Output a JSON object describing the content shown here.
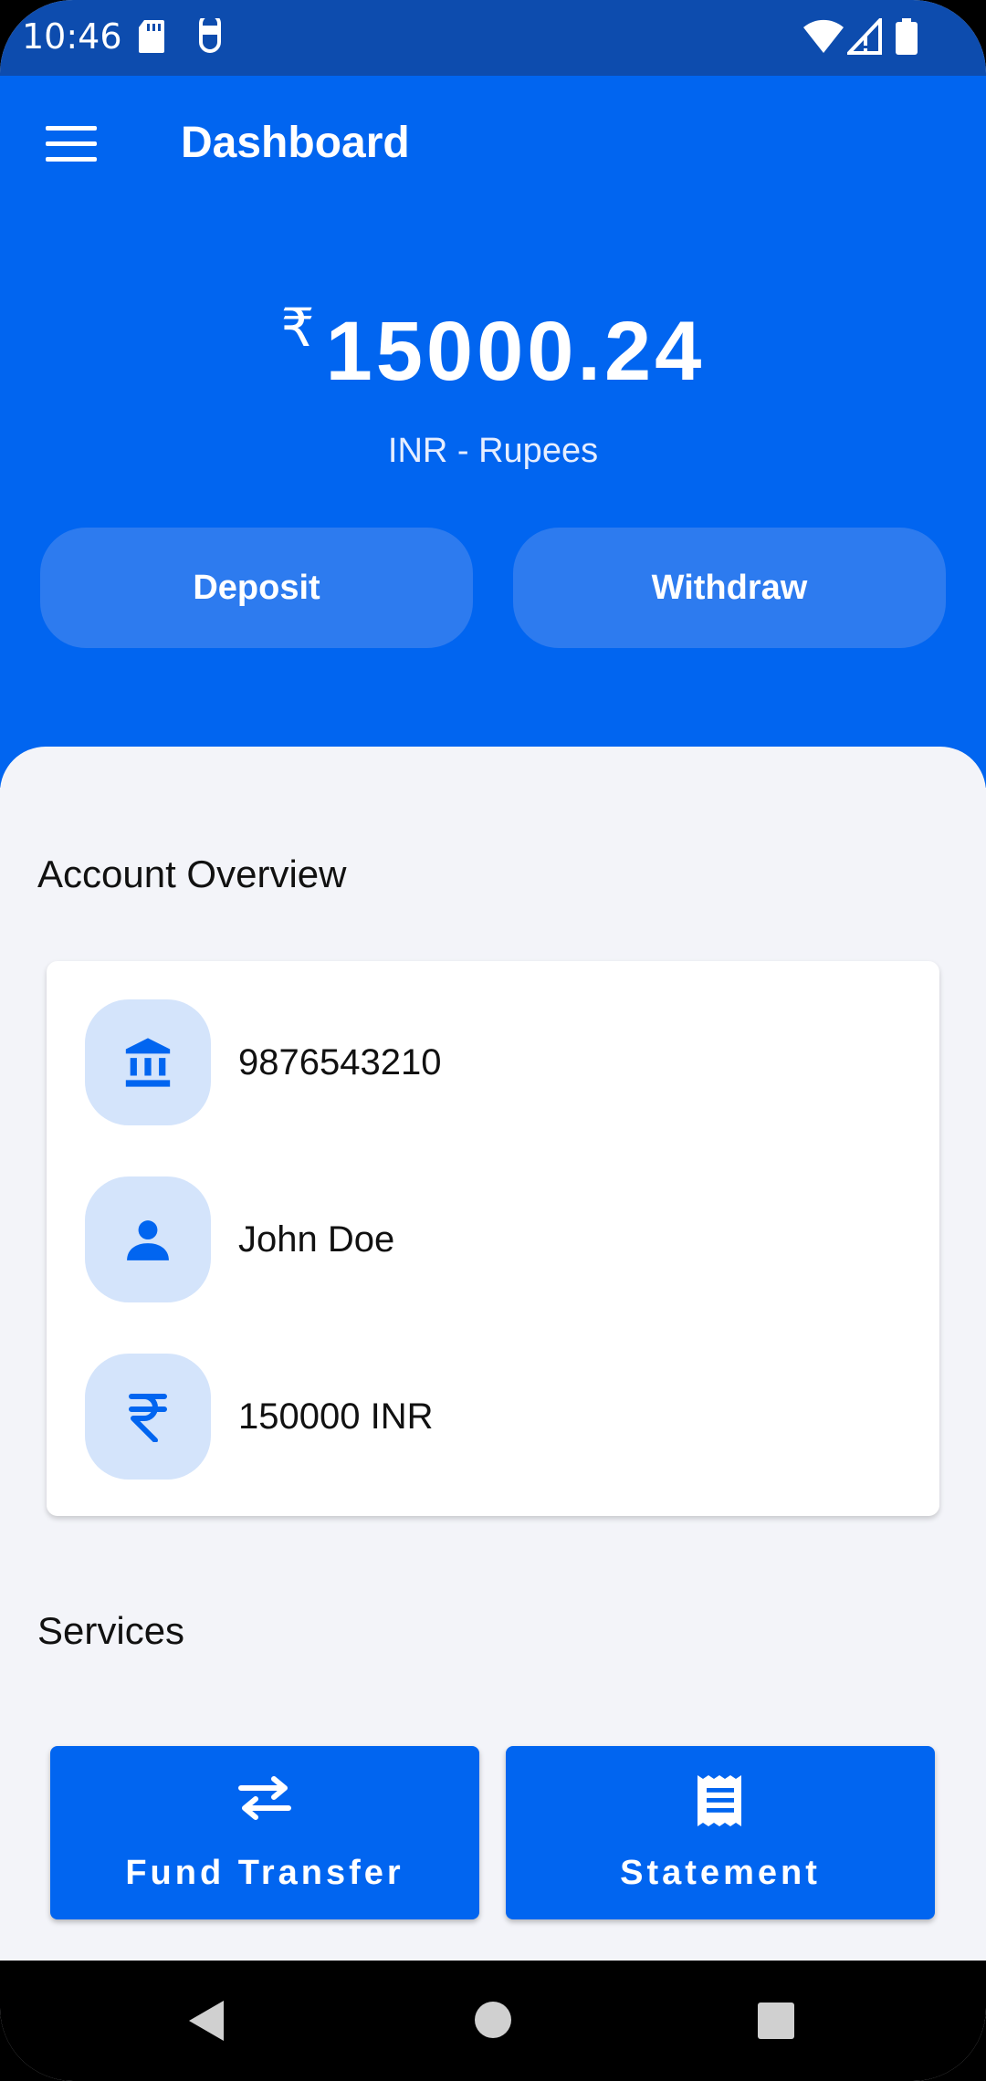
{
  "status_bar": {
    "time": "10:46"
  },
  "header": {
    "title": "Dashboard"
  },
  "balance": {
    "symbol": "₹",
    "amount": "15000.24",
    "currency_label": "INR - Rupees"
  },
  "actions": {
    "deposit_label": "Deposit",
    "withdraw_label": "Withdraw"
  },
  "overview": {
    "title": "Account Overview",
    "rows": [
      {
        "icon": "bank-icon",
        "text": "9876543210"
      },
      {
        "icon": "person-icon",
        "text": "John Doe"
      },
      {
        "icon": "rupee-icon",
        "text": "150000 INR"
      }
    ]
  },
  "services": {
    "title": "Services",
    "items": [
      {
        "icon": "transfer-icon",
        "label": "Fund Transfer"
      },
      {
        "icon": "receipt-icon",
        "label": "Statement"
      }
    ]
  },
  "colors": {
    "primary": "#0165F0",
    "status_bar": "#0D4CAE",
    "icon_bg": "#D4E4FB",
    "background": "#F3F4F9"
  }
}
